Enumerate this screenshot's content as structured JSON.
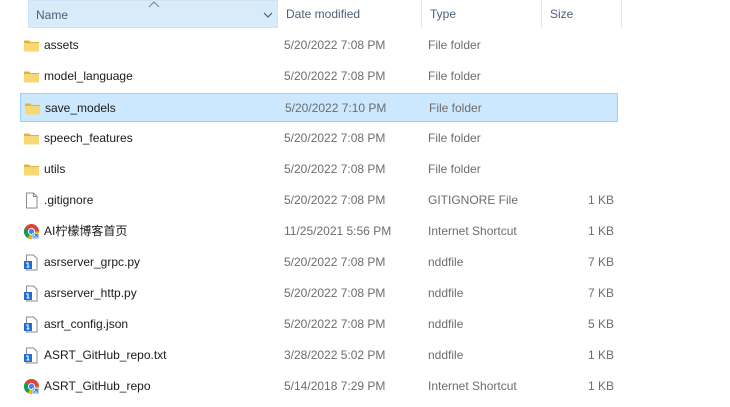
{
  "columns": {
    "name": "Name",
    "date_modified": "Date modified",
    "type": "Type",
    "size": "Size"
  },
  "colors": {
    "folder": "#f8d775",
    "folder_dark": "#e2b33c",
    "selection": "#cce8ff",
    "selection_border": "#99d1ff",
    "header_text": "#4c607a"
  },
  "files": [
    {
      "name": "assets",
      "date": "5/20/2022 7:08 PM",
      "type": "File folder",
      "size": "",
      "icon": "folder-icon"
    },
    {
      "name": "model_language",
      "date": "5/20/2022 7:08 PM",
      "type": "File folder",
      "size": "",
      "icon": "folder-icon"
    },
    {
      "name": "save_models",
      "date": "5/20/2022 7:10 PM",
      "type": "File folder",
      "size": "",
      "icon": "folder-icon",
      "selected": true
    },
    {
      "name": "speech_features",
      "date": "5/20/2022 7:08 PM",
      "type": "File folder",
      "size": "",
      "icon": "folder-icon"
    },
    {
      "name": "utils",
      "date": "5/20/2022 7:08 PM",
      "type": "File folder",
      "size": "",
      "icon": "folder-icon"
    },
    {
      "name": ".gitignore",
      "date": "5/20/2022 7:08 PM",
      "type": "GITIGNORE File",
      "size": "1 KB",
      "icon": "document-icon"
    },
    {
      "name": "AI柠檬博客首页",
      "date": "11/25/2021 5:56 PM",
      "type": "Internet Shortcut",
      "size": "1 KB",
      "icon": "chrome-icon"
    },
    {
      "name": "asrserver_grpc.py",
      "date": "5/20/2022 7:08 PM",
      "type": "nddfile",
      "size": "7 KB",
      "icon": "nddfile-icon"
    },
    {
      "name": "asrserver_http.py",
      "date": "5/20/2022 7:08 PM",
      "type": "nddfile",
      "size": "7 KB",
      "icon": "nddfile-icon"
    },
    {
      "name": "asrt_config.json",
      "date": "5/20/2022 7:08 PM",
      "type": "nddfile",
      "size": "5 KB",
      "icon": "nddfile-icon"
    },
    {
      "name": "ASRT_GitHub_repo.txt",
      "date": "3/28/2022 5:02 PM",
      "type": "nddfile",
      "size": "1 KB",
      "icon": "nddfile-icon"
    },
    {
      "name": "ASRT_GitHub_repo",
      "date": "5/14/2018 7:29 PM",
      "type": "Internet Shortcut",
      "size": "1 KB",
      "icon": "chrome-icon"
    }
  ]
}
